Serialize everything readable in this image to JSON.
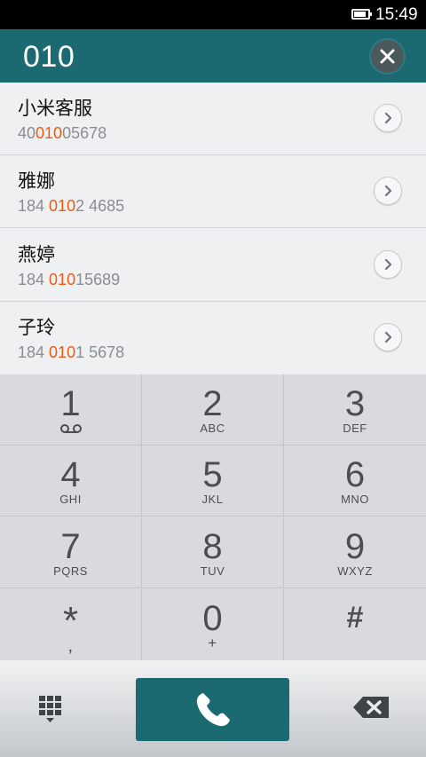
{
  "status_bar": {
    "time": "15:49",
    "battery_level": 0.85
  },
  "dialer": {
    "input": "010"
  },
  "contacts": [
    {
      "name": "小米客服",
      "number_pre": "40",
      "number_match": "010",
      "number_post": "05678"
    },
    {
      "name": "雅娜",
      "number_pre": "184 ",
      "number_match": "010",
      "number_post": "2 4685"
    },
    {
      "name": "燕婷",
      "number_pre": "184 ",
      "number_match": "010",
      "number_post": "15689"
    },
    {
      "name": "子玲",
      "number_pre": "184 ",
      "number_match": "010",
      "number_post": "1 5678"
    }
  ],
  "keypad": [
    {
      "digit": "1",
      "letters": "",
      "icon": "voicemail-icon"
    },
    {
      "digit": "2",
      "letters": "ABC"
    },
    {
      "digit": "3",
      "letters": "DEF"
    },
    {
      "digit": "4",
      "letters": "GHI"
    },
    {
      "digit": "5",
      "letters": "JKL"
    },
    {
      "digit": "6",
      "letters": "MNO"
    },
    {
      "digit": "7",
      "letters": "PQRS"
    },
    {
      "digit": "8",
      "letters": "TUV"
    },
    {
      "digit": "9",
      "letters": "WXYZ"
    },
    {
      "digit": "*",
      "letters": ","
    },
    {
      "digit": "0",
      "letters": "+"
    },
    {
      "digit": "#",
      "letters": ""
    }
  ],
  "icons": {
    "clear": "close-icon",
    "row_action": "chevron-right-icon",
    "keypad_toggle": "keypad-grid-icon",
    "call": "phone-icon",
    "backspace": "backspace-icon"
  },
  "colors": {
    "accent": "#1b6a72",
    "match_highlight": "#f05a14"
  }
}
